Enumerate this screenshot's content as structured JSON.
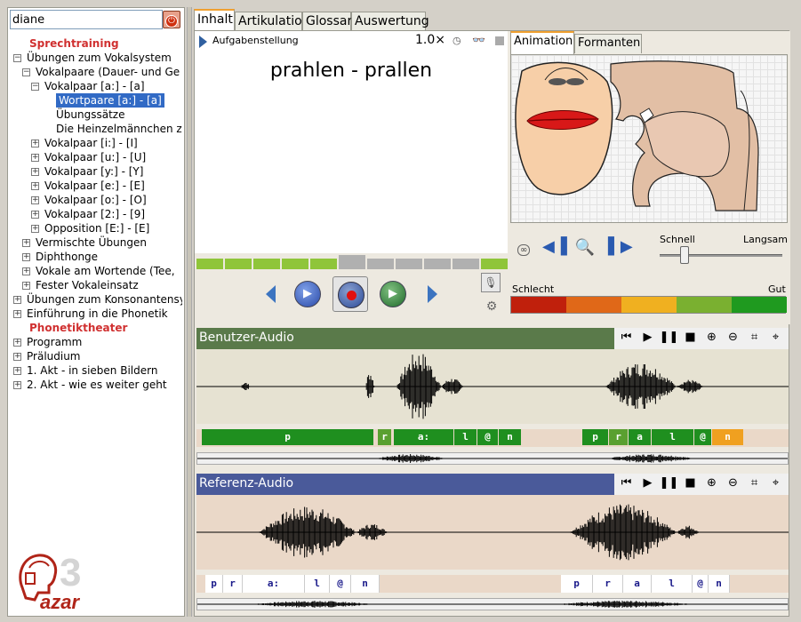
{
  "sidebar": {
    "search_value": "diane",
    "power_glyph": "⏻",
    "tree": [
      {
        "label": "Sprechtraining",
        "style": "red"
      },
      {
        "label": "Übungen zum Vokalsystem",
        "toggle": "−"
      },
      {
        "label": "Vokalpaare (Dauer- und Ge",
        "toggle": "−"
      },
      {
        "label": "Vokalpaar [a:] - [a]",
        "toggle": "−"
      },
      {
        "label": "Wortpaare [a:] - [a]",
        "style": "sel"
      },
      {
        "label": "Übungssätze"
      },
      {
        "label": "Die Heinzelmännchen zu"
      },
      {
        "label": "Vokalpaar [i:] - [I]",
        "toggle": "+"
      },
      {
        "label": "Vokalpaar [u:] - [U]",
        "toggle": "+"
      },
      {
        "label": "Vokalpaar [y:] - [Y]",
        "toggle": "+"
      },
      {
        "label": "Vokalpaar [e:] - [E]",
        "toggle": "+"
      },
      {
        "label": "Vokalpaar [o:] - [O]",
        "toggle": "+"
      },
      {
        "label": "Vokalpaar [2:] - [9]",
        "toggle": "+"
      },
      {
        "label": "Opposition [E:] - [E]",
        "toggle": "+"
      },
      {
        "label": "Vermischte Übungen",
        "toggle": "+"
      },
      {
        "label": "Diphthonge",
        "toggle": "+"
      },
      {
        "label": "Vokale am Wortende (Tee,",
        "toggle": "+"
      },
      {
        "label": "Fester Vokaleinsatz",
        "toggle": "+"
      },
      {
        "label": "Übungen zum Konsonantensy",
        "toggle": "+"
      },
      {
        "label": "Einführung in die Phonetik",
        "toggle": "+"
      },
      {
        "label": "Phonetiktheater",
        "style": "red"
      },
      {
        "label": "Programm",
        "toggle": "+"
      },
      {
        "label": "Präludium",
        "toggle": "+"
      },
      {
        "label": "1. Akt - in sieben Bildern",
        "toggle": "+"
      },
      {
        "label": "2. Akt - wie es weiter geht",
        "toggle": "+"
      }
    ],
    "logo_text": "azar",
    "logo_number": "3"
  },
  "tabs": [
    "Inhalt",
    "Artikulation",
    "Glossar",
    "Auswertung"
  ],
  "exercise": {
    "header_label": "Aufgabenstellung",
    "speed": "1.0×",
    "word": "prahlen - prallen"
  },
  "animation": {
    "tabs": [
      "Animation",
      "Formanten"
    ],
    "speed_fast": "Schnell",
    "speed_slow": "Langsam",
    "speed_fraction": 0.2
  },
  "rating": {
    "bad": "Schlecht",
    "good": "Gut",
    "colors": [
      "#c0200c",
      "#e06818",
      "#f0b020",
      "#7ab030",
      "#1f9a1f"
    ]
  },
  "user_audio": {
    "title": "Benutzer-Audio",
    "header_color": "#5a7a4a",
    "segments": [
      {
        "label": "p",
        "color": "#1f8f1f"
      },
      {
        "label": "r",
        "color": "#5aa030"
      },
      {
        "label": "a:",
        "color": "#1f8f1f"
      },
      {
        "label": "l",
        "color": "#1f8f1f"
      },
      {
        "label": "@",
        "color": "#1f8f1f"
      },
      {
        "label": "n",
        "color": "#1f8f1f"
      },
      {
        "label": "p",
        "color": "#1f8f1f"
      },
      {
        "label": "r",
        "color": "#5aa030"
      },
      {
        "label": "a",
        "color": "#1f8f1f"
      },
      {
        "label": "l",
        "color": "#1f8f1f"
      },
      {
        "label": "@",
        "color": "#1f8f1f"
      },
      {
        "label": "n",
        "color": "#f0a020"
      }
    ]
  },
  "ref_audio": {
    "title": "Referenz-Audio",
    "header_color": "#4a5a9a",
    "segments": [
      "p",
      "r",
      "a:",
      "l",
      "@",
      "n",
      "p",
      "r",
      "a",
      "l",
      "@",
      "n"
    ]
  },
  "icons": {
    "play": "play-icon",
    "record": "record-icon",
    "prev": "prev-icon",
    "next": "next-icon",
    "mic": "microphone-icon",
    "gear": "gear-icon"
  }
}
